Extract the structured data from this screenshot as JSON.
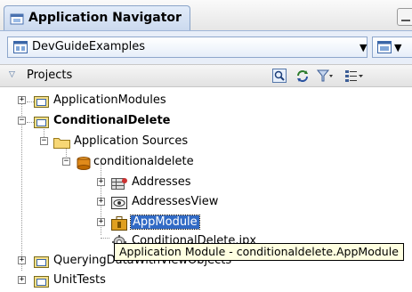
{
  "panel": {
    "title": "Application Navigator",
    "icon": "application-navigator-icon"
  },
  "application_selector": {
    "value": "DevGuideExamples",
    "icon": "application-icon"
  },
  "projects_header": {
    "label": "Projects",
    "toolbar": [
      "find-icon",
      "refresh-icon",
      "filter-icon",
      "sort-icon"
    ]
  },
  "tree": {
    "application_modules": "ApplicationModules",
    "conditional_delete": "ConditionalDelete",
    "application_sources": "Application Sources",
    "package": "conditionaldelete",
    "addresses": "Addresses",
    "addresses_view": "AddressesView",
    "app_module": "AppModule",
    "jpx": "ConditionalDelete.jpx",
    "querying": "QueryingDataWithViewObjects",
    "unit_tests": "UnitTests"
  },
  "tooltip": "Application Module - conditionaldelete.AppModule",
  "colors": {
    "selection": "#316ac5",
    "tooltip_bg": "#ffffe1",
    "header_blue": "#cbd9ee"
  }
}
